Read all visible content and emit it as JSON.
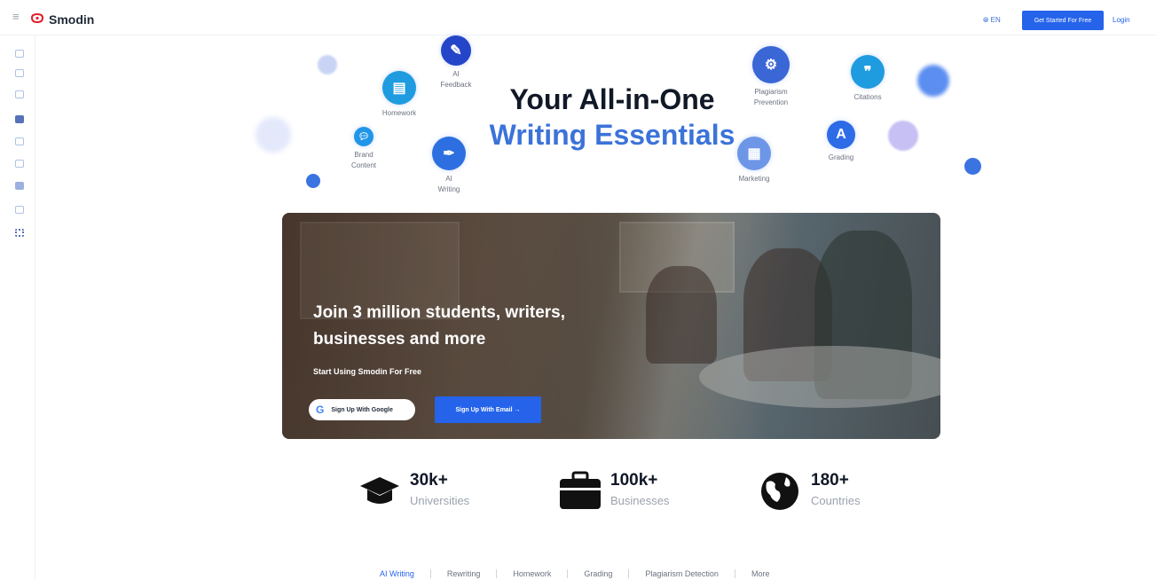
{
  "app": {
    "name": "Smodin"
  },
  "header": {
    "language": "EN",
    "cta_label": "Get Started For Free",
    "login_label": "Login"
  },
  "sidebar": {
    "icons": [
      "chat-icon",
      "document-icon",
      "edit-icon",
      "message-icon",
      "feedback-icon",
      "text-icon",
      "comment-icon",
      "list-icon",
      "grid-icon"
    ]
  },
  "hero": {
    "title_line1": "Your All-in-One",
    "title_line2": "Writing Essentials"
  },
  "features": [
    {
      "icon": "lightbulb-icon",
      "label": "AI\nFeedback"
    },
    {
      "icon": "book-icon",
      "label": "Homework"
    },
    {
      "icon": "chat-bubble-icon",
      "label": "Brand\nContent"
    },
    {
      "icon": "pen-icon",
      "label": "AI\nWriting"
    },
    {
      "icon": "brain-icon",
      "label": "Plagiarism\nPrevention"
    },
    {
      "icon": "quote-icon",
      "label": "Citations"
    },
    {
      "icon": "grade-icon",
      "label": "Grading"
    },
    {
      "icon": "calendar-icon",
      "label": "Marketing"
    }
  ],
  "banner": {
    "headline": "Join 3 million students, writers, businesses and more",
    "subline": "Start Using Smodin For Free",
    "google_label": "Sign Up With Google",
    "email_label": "Sign Up With Email →"
  },
  "stats": [
    {
      "icon": "graduation-cap-icon",
      "value": "30k+",
      "caption": "Universities"
    },
    {
      "icon": "briefcase-icon",
      "value": "100k+",
      "caption": "Businesses"
    },
    {
      "icon": "globe-icon",
      "value": "180+",
      "caption": "Countries"
    }
  ],
  "tabs": [
    "AI Writing",
    "Rewriting",
    "Homework",
    "Grading",
    "Plagiarism Detection",
    "More"
  ],
  "colors": {
    "accent": "#2563eb",
    "title_blue": "#3b73d9"
  }
}
